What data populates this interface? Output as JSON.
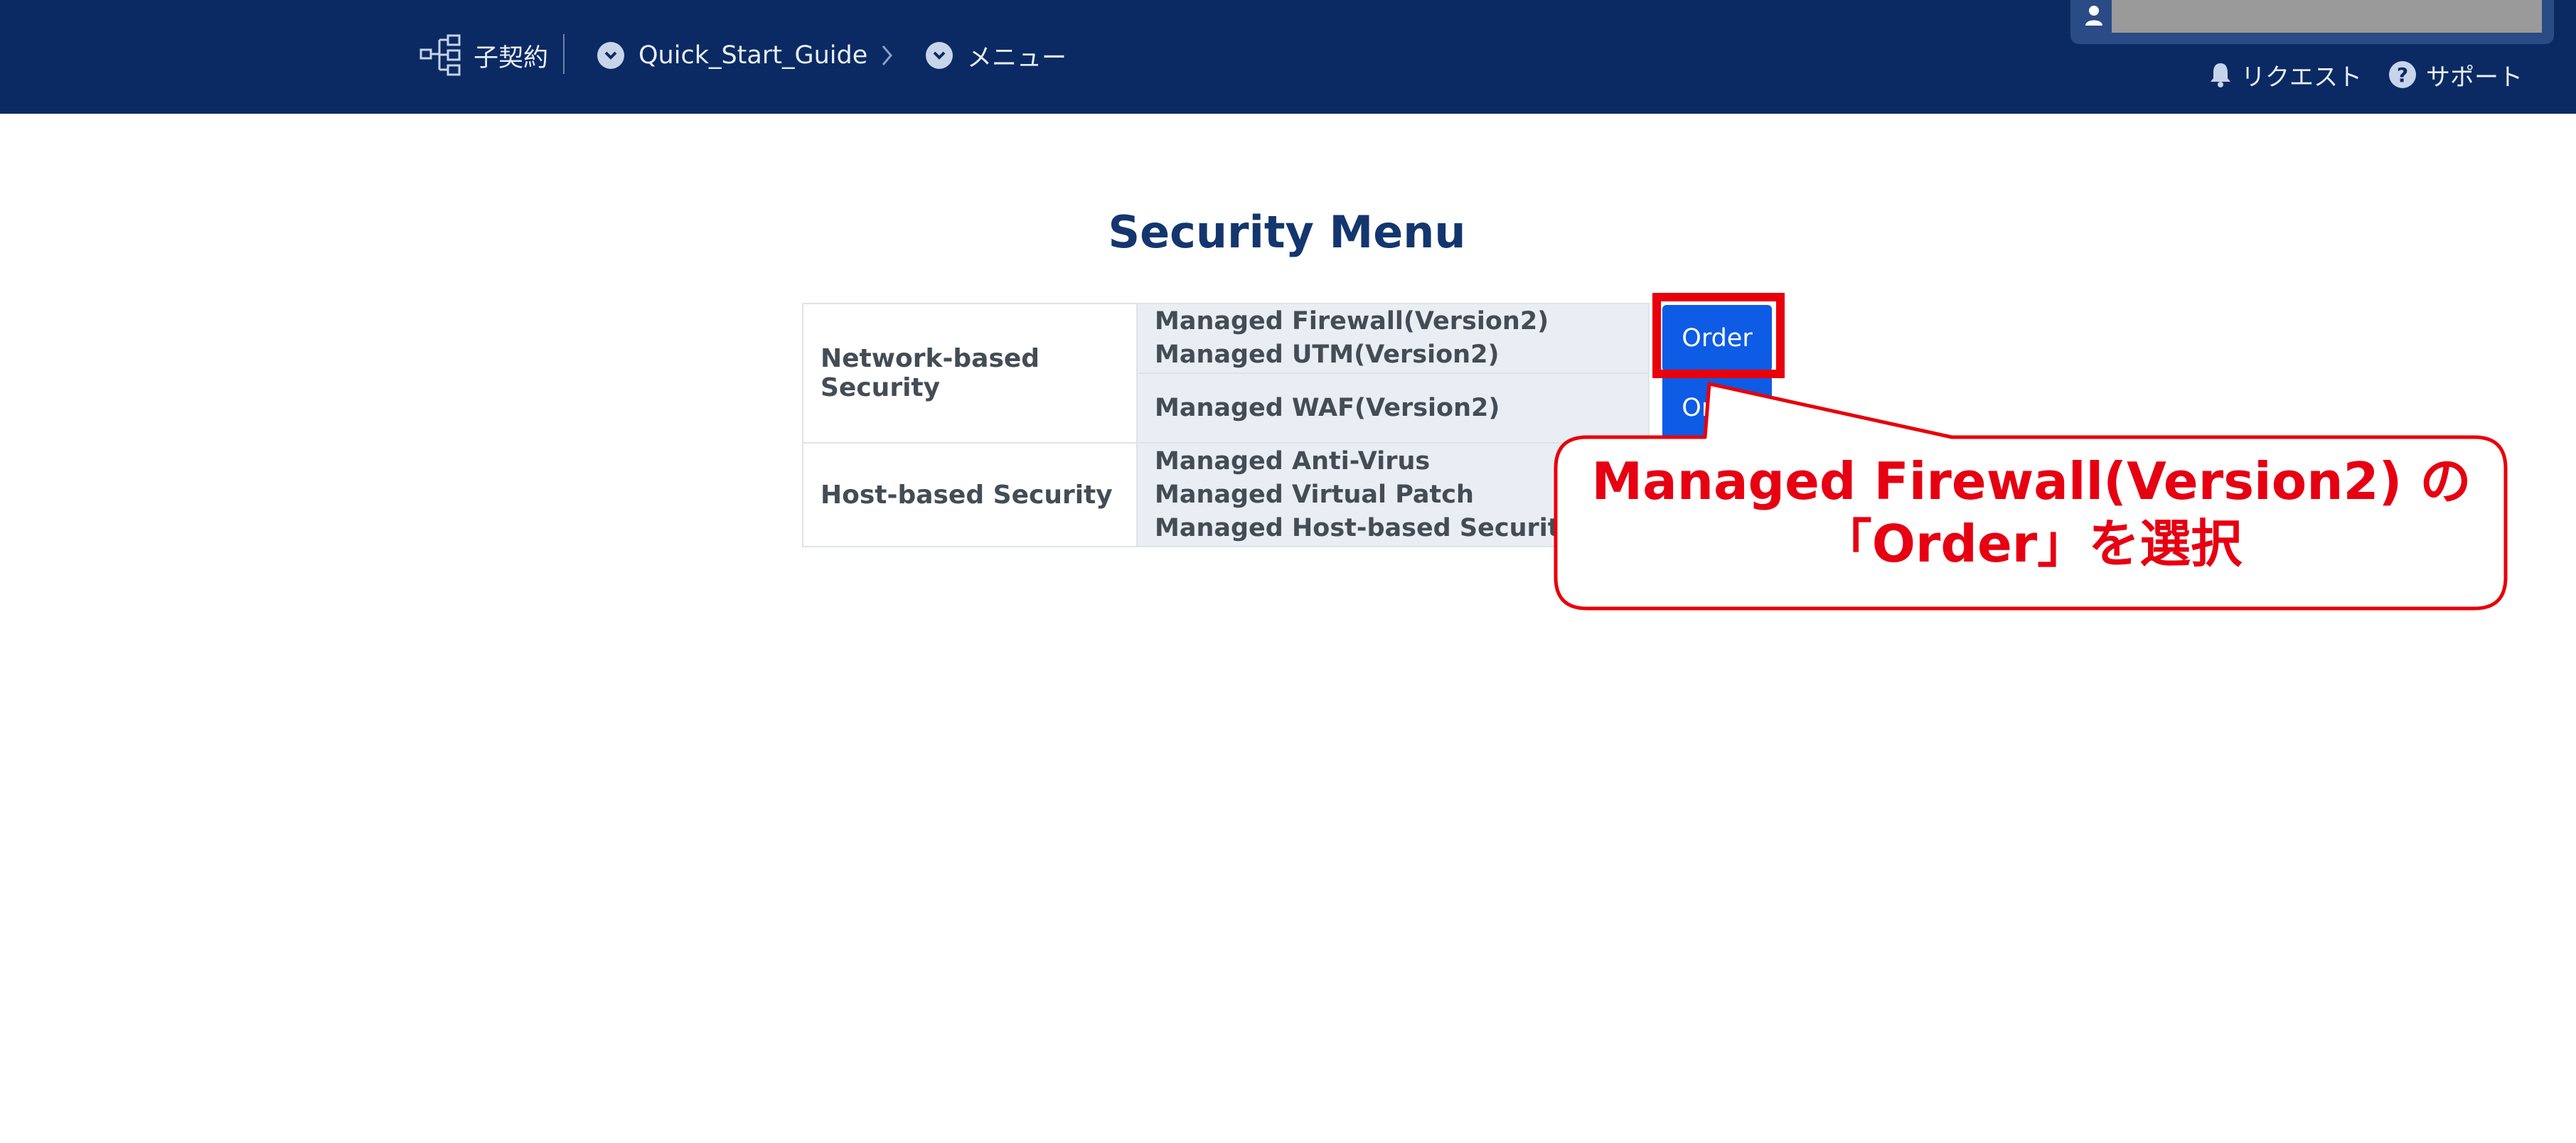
{
  "header": {
    "contract_label": "子契約",
    "breadcrumb": [
      {
        "label": "Quick_Start_Guide"
      },
      {
        "label": "メニュー"
      }
    ],
    "request_label": "リクエスト",
    "support_label": "サポート"
  },
  "page": {
    "title": "Security Menu"
  },
  "menu": {
    "rows": [
      {
        "category": "Network-based Security",
        "groups": [
          {
            "services": [
              "Managed Firewall(Version2)",
              "Managed UTM(Version2)"
            ],
            "button": "Order"
          },
          {
            "services": [
              "Managed WAF(Version2)"
            ],
            "button": "Order"
          }
        ]
      },
      {
        "category": "Host-based Security",
        "groups": [
          {
            "services": [
              "Managed Anti-Virus",
              "Managed Virtual Patch",
              "Managed Host-based Security P"
            ],
            "button": ""
          }
        ]
      }
    ]
  },
  "annotation": {
    "line1": "Managed Firewall(Version2) の",
    "line2": "「Order」を選択",
    "color": "#e60012"
  },
  "colors": {
    "header_bg": "#0b2a63",
    "title": "#14366f",
    "button": "#0e5be6",
    "highlight": "#e8000a"
  }
}
